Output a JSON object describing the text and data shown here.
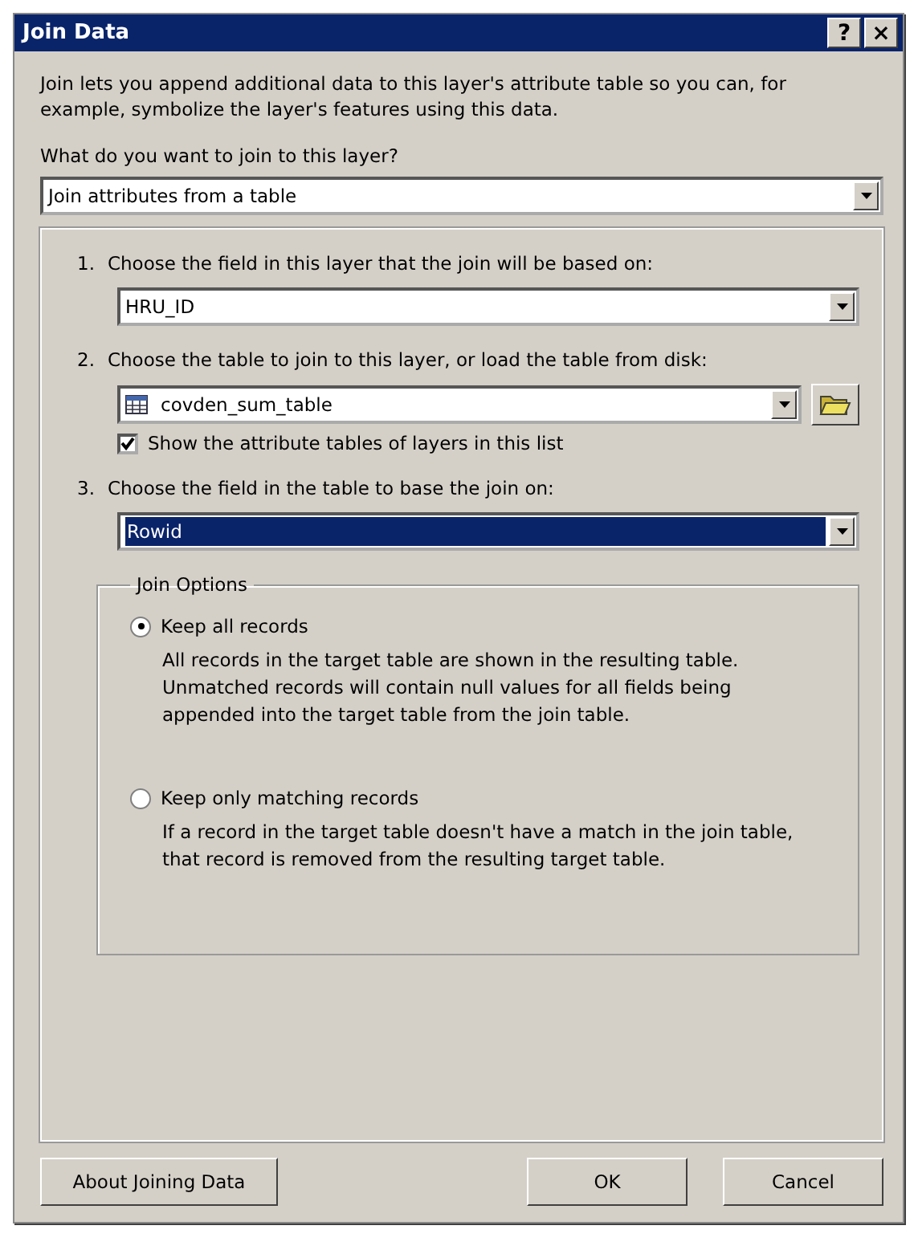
{
  "window": {
    "title": "Join Data",
    "title_buttons": [
      "?",
      "×"
    ]
  },
  "intro": "Join lets you append additional data to this layer's attribute table so you can, for example, symbolize the layer's features using this data.",
  "join_type": {
    "label": "What do you want to join to this layer?",
    "value": "Join attributes from a table"
  },
  "steps": [
    {
      "number": "1.",
      "label": "Choose the field in this layer that the join will be based on:",
      "value": "HRU_ID",
      "kind": "field",
      "selected": false
    },
    {
      "number": "2.",
      "label": "Choose the table to join to this layer, or load the table from disk:",
      "value": "covden_sum_table",
      "kind": "table",
      "selected": false,
      "checkbox": {
        "label": "Show the attribute tables of layers in this list",
        "checked": true
      }
    },
    {
      "number": "3.",
      "label": "Choose the field in the table to base the join on:",
      "value": "Rowid",
      "kind": "field",
      "selected": true
    }
  ],
  "join_options": {
    "title": "Join Options",
    "options": [
      {
        "label": "Keep all records",
        "description": "All records in the target table are shown in the resulting table. Unmatched records will contain null values for all fields being appended into the target table from the join table.",
        "selected": true
      },
      {
        "label": "Keep only matching records",
        "description": "If a record in the target table doesn't have a match in the join table, that record is removed from the resulting target table.",
        "selected": false
      }
    ]
  },
  "buttons": {
    "left": "About Joining Data",
    "right": [
      "OK",
      "Cancel"
    ]
  }
}
